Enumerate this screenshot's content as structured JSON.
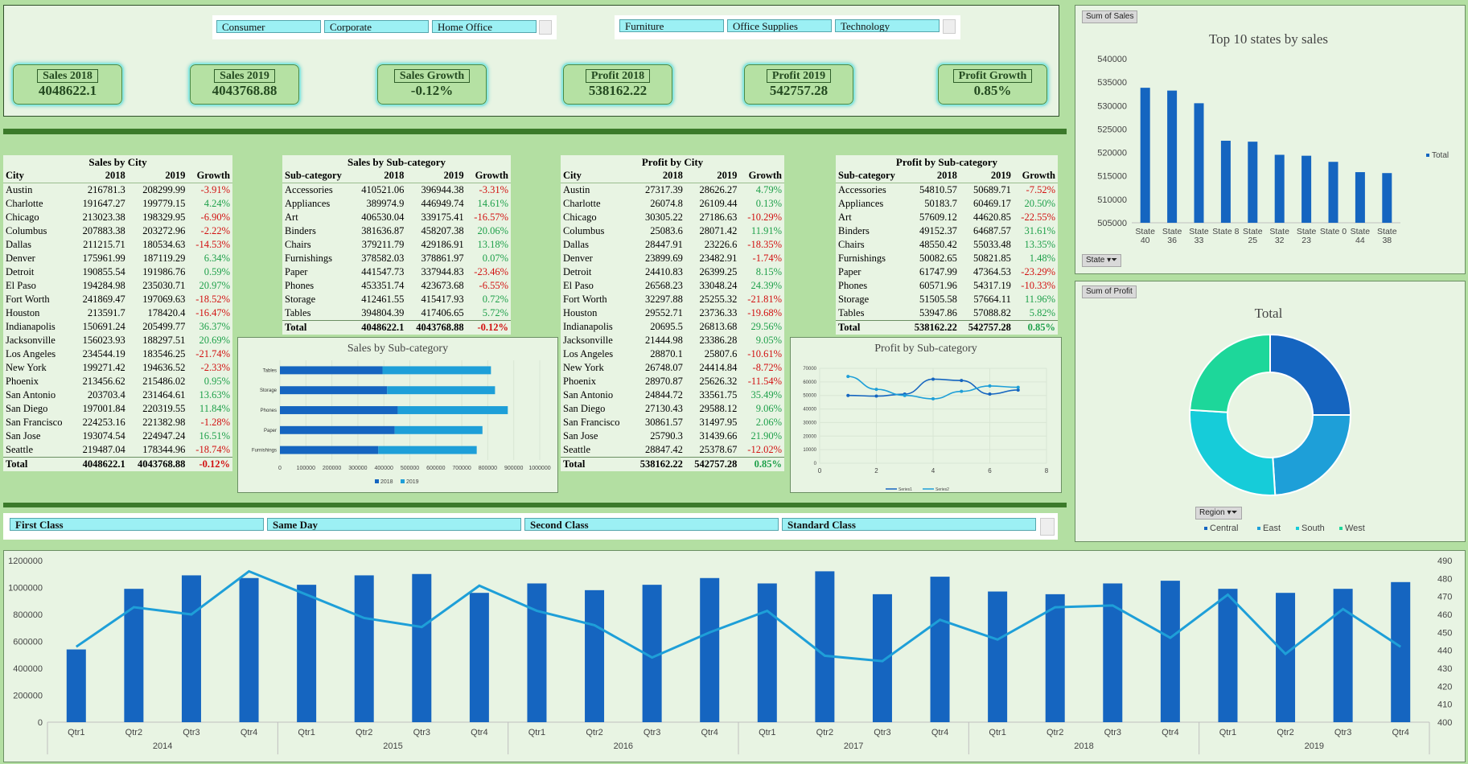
{
  "segment_slicer": [
    "Consumer",
    "Corporate",
    "Home Office"
  ],
  "category_slicer": [
    "Furniture",
    "Office Supplies",
    "Technology"
  ],
  "ship_slicer": [
    "First Class",
    "Same Day",
    "Second Class",
    "Standard Class"
  ],
  "kpis": [
    {
      "label": "Sales 2018",
      "value": "4048622.1"
    },
    {
      "label": "Sales 2019",
      "value": "4043768.88"
    },
    {
      "label": "Sales Growth",
      "value": "-0.12%"
    },
    {
      "label": "Profit 2018",
      "value": "538162.22"
    },
    {
      "label": "Profit 2019",
      "value": "542757.28"
    },
    {
      "label": "Profit Growth",
      "value": "0.85%"
    }
  ],
  "tables": {
    "sales_city": {
      "title": "Sales by City",
      "headers": [
        "City",
        "2018",
        "2019",
        "Growth"
      ],
      "rows": [
        [
          "Austin",
          "216781.3",
          "208299.99",
          "-3.91%"
        ],
        [
          "Charlotte",
          "191647.27",
          "199779.15",
          "4.24%"
        ],
        [
          "Chicago",
          "213023.38",
          "198329.95",
          "-6.90%"
        ],
        [
          "Columbus",
          "207883.38",
          "203272.96",
          "-2.22%"
        ],
        [
          "Dallas",
          "211215.71",
          "180534.63",
          "-14.53%"
        ],
        [
          "Denver",
          "175961.99",
          "187119.29",
          "6.34%"
        ],
        [
          "Detroit",
          "190855.54",
          "191986.76",
          "0.59%"
        ],
        [
          "El Paso",
          "194284.98",
          "235030.71",
          "20.97%"
        ],
        [
          "Fort Worth",
          "241869.47",
          "197069.63",
          "-18.52%"
        ],
        [
          "Houston",
          "213591.7",
          "178420.4",
          "-16.47%"
        ],
        [
          "Indianapolis",
          "150691.24",
          "205499.77",
          "36.37%"
        ],
        [
          "Jacksonville",
          "156023.93",
          "188297.51",
          "20.69%"
        ],
        [
          "Los Angeles",
          "234544.19",
          "183546.25",
          "-21.74%"
        ],
        [
          "New York",
          "199271.42",
          "194636.52",
          "-2.33%"
        ],
        [
          "Phoenix",
          "213456.62",
          "215486.02",
          "0.95%"
        ],
        [
          "San Antonio",
          "203703.4",
          "231464.61",
          "13.63%"
        ],
        [
          "San Diego",
          "197001.84",
          "220319.55",
          "11.84%"
        ],
        [
          "San Francisco",
          "224253.16",
          "221382.98",
          "-1.28%"
        ],
        [
          "San Jose",
          "193074.54",
          "224947.24",
          "16.51%"
        ],
        [
          "Seattle",
          "219487.04",
          "178344.96",
          "-18.74%"
        ]
      ],
      "total": [
        "Total",
        "4048622.1",
        "4043768.88",
        "-0.12%"
      ]
    },
    "sales_sub": {
      "title": "Sales by Sub-category",
      "headers": [
        "Sub-category",
        "2018",
        "2019",
        "Growth"
      ],
      "rows": [
        [
          "Accessories",
          "410521.06",
          "396944.38",
          "-3.31%"
        ],
        [
          "Appliances",
          "389974.9",
          "446949.74",
          "14.61%"
        ],
        [
          "Art",
          "406530.04",
          "339175.41",
          "-16.57%"
        ],
        [
          "Binders",
          "381636.87",
          "458207.38",
          "20.06%"
        ],
        [
          "Chairs",
          "379211.79",
          "429186.91",
          "13.18%"
        ],
        [
          "Furnishings",
          "378582.03",
          "378861.97",
          "0.07%"
        ],
        [
          "Paper",
          "441547.73",
          "337944.83",
          "-23.46%"
        ],
        [
          "Phones",
          "453351.74",
          "423673.68",
          "-6.55%"
        ],
        [
          "Storage",
          "412461.55",
          "415417.93",
          "0.72%"
        ],
        [
          "Tables",
          "394804.39",
          "417406.65",
          "5.72%"
        ]
      ],
      "total": [
        "Total",
        "4048622.1",
        "4043768.88",
        "-0.12%"
      ]
    },
    "profit_city": {
      "title": "Profit by City",
      "headers": [
        "City",
        "2018",
        "2019",
        "Growth"
      ],
      "rows": [
        [
          "Austin",
          "27317.39",
          "28626.27",
          "4.79%"
        ],
        [
          "Charlotte",
          "26074.8",
          "26109.44",
          "0.13%"
        ],
        [
          "Chicago",
          "30305.22",
          "27186.63",
          "-10.29%"
        ],
        [
          "Columbus",
          "25083.6",
          "28071.42",
          "11.91%"
        ],
        [
          "Dallas",
          "28447.91",
          "23226.6",
          "-18.35%"
        ],
        [
          "Denver",
          "23899.69",
          "23482.91",
          "-1.74%"
        ],
        [
          "Detroit",
          "24410.83",
          "26399.25",
          "8.15%"
        ],
        [
          "El Paso",
          "26568.23",
          "33048.24",
          "24.39%"
        ],
        [
          "Fort Worth",
          "32297.88",
          "25255.32",
          "-21.81%"
        ],
        [
          "Houston",
          "29552.71",
          "23736.33",
          "-19.68%"
        ],
        [
          "Indianapolis",
          "20695.5",
          "26813.68",
          "29.56%"
        ],
        [
          "Jacksonville",
          "21444.98",
          "23386.28",
          "9.05%"
        ],
        [
          "Los Angeles",
          "28870.1",
          "25807.6",
          "-10.61%"
        ],
        [
          "New York",
          "26748.07",
          "24414.84",
          "-8.72%"
        ],
        [
          "Phoenix",
          "28970.87",
          "25626.32",
          "-11.54%"
        ],
        [
          "San Antonio",
          "24844.72",
          "33561.75",
          "35.49%"
        ],
        [
          "San Diego",
          "27130.43",
          "29588.12",
          "9.06%"
        ],
        [
          "San Francisco",
          "30861.57",
          "31497.95",
          "2.06%"
        ],
        [
          "San Jose",
          "25790.3",
          "31439.66",
          "21.90%"
        ],
        [
          "Seattle",
          "28847.42",
          "25378.67",
          "-12.02%"
        ]
      ],
      "total": [
        "Total",
        "538162.22",
        "542757.28",
        "0.85%"
      ]
    },
    "profit_sub": {
      "title": "Profit by Sub-category",
      "headers": [
        "Sub-category",
        "2018",
        "2019",
        "Growth"
      ],
      "rows": [
        [
          "Accessories",
          "54810.57",
          "50689.71",
          "-7.52%"
        ],
        [
          "Appliances",
          "50183.7",
          "60469.17",
          "20.50%"
        ],
        [
          "Art",
          "57609.12",
          "44620.85",
          "-22.55%"
        ],
        [
          "Binders",
          "49152.37",
          "64687.57",
          "31.61%"
        ],
        [
          "Chairs",
          "48550.42",
          "55033.48",
          "13.35%"
        ],
        [
          "Furnishings",
          "50082.65",
          "50821.85",
          "1.48%"
        ],
        [
          "Paper",
          "61747.99",
          "47364.53",
          "-23.29%"
        ],
        [
          "Phones",
          "60571.96",
          "54317.19",
          "-10.33%"
        ],
        [
          "Storage",
          "51505.58",
          "57664.11",
          "11.96%"
        ],
        [
          "Tables",
          "53947.86",
          "57088.82",
          "5.82%"
        ]
      ],
      "total": [
        "Total",
        "538162.22",
        "542757.28",
        "0.85%"
      ]
    }
  },
  "pivot_buttons": {
    "sum_sales": "Sum of Sales",
    "state": "State",
    "sum_profit": "Sum of Profit",
    "region": "Region"
  },
  "chart_data": [
    {
      "type": "bar",
      "title": "Sales by Sub-category",
      "categories": [
        "Furnishings",
        "Paper",
        "Phones",
        "Storage",
        "Tables"
      ],
      "series": [
        {
          "name": "2018",
          "values": [
            378582.03,
            441547.73,
            453351.74,
            412461.55,
            394804.39
          ],
          "color": "#1565c0"
        },
        {
          "name": "2019",
          "values": [
            378861.97,
            337944.83,
            423673.68,
            415417.93,
            417406.65
          ],
          "color": "#1e9fd8"
        }
      ],
      "orientation": "horizontal-stacked",
      "xlim": [
        0,
        1000000
      ],
      "xticks": [
        0,
        100000,
        200000,
        300000,
        400000,
        500000,
        600000,
        700000,
        800000,
        900000,
        1000000
      ],
      "legend": "bottom"
    },
    {
      "type": "line",
      "title": "Profit by Sub-category",
      "series": [
        {
          "name": "Series1",
          "x": [
            1,
            2,
            3,
            4,
            5,
            6,
            7
          ],
          "values": [
            50000,
            49500,
            51000,
            62000,
            61000,
            51000,
            54000
          ],
          "color": "#1565c0"
        },
        {
          "name": "Series2",
          "x": [
            1,
            2,
            3,
            4,
            5,
            6,
            7
          ],
          "values": [
            64000,
            54500,
            50000,
            47500,
            53000,
            57000,
            56000
          ],
          "color": "#1e9fd8"
        }
      ],
      "xlim": [
        0,
        8
      ],
      "xticks": [
        0,
        2,
        4,
        6,
        8
      ],
      "ylim": [
        0,
        70000
      ],
      "yticks": [
        0,
        10000,
        20000,
        30000,
        40000,
        50000,
        60000,
        70000
      ],
      "legend": "bottom"
    },
    {
      "type": "bar",
      "title": "Top 10 states by sales",
      "categories": [
        [
          "State",
          "40"
        ],
        [
          "State",
          "36"
        ],
        [
          "State",
          "33"
        ],
        [
          "State 8"
        ],
        [
          "State",
          "25"
        ],
        [
          "State",
          "32"
        ],
        [
          "State",
          "23"
        ],
        [
          "State 0"
        ],
        [
          "State",
          "44"
        ],
        [
          "State",
          "38"
        ]
      ],
      "series": [
        {
          "name": "Total",
          "values": [
            533800,
            533200,
            530500,
            522500,
            522300,
            519500,
            519300,
            518000,
            515800,
            515600
          ],
          "color": "#1565c0"
        }
      ],
      "ylim": [
        505000,
        540000
      ],
      "yticks": [
        505000,
        510000,
        515000,
        520000,
        525000,
        530000,
        535000,
        540000
      ],
      "legend": "right"
    },
    {
      "type": "pie",
      "subtype": "doughnut",
      "title": "Total",
      "labels": [
        "Central",
        "East",
        "South",
        "West"
      ],
      "values": [
        25,
        24,
        27,
        24
      ],
      "colors": [
        "#1565c0",
        "#1e9fd8",
        "#16ccd9",
        "#1dd79a"
      ],
      "legend": "bottom"
    },
    {
      "type": "bar",
      "subtype": "combo bar + line",
      "categories": [
        "Qtr1",
        "Qtr2",
        "Qtr3",
        "Qtr4",
        "Qtr1",
        "Qtr2",
        "Qtr3",
        "Qtr4",
        "Qtr1",
        "Qtr2",
        "Qtr3",
        "Qtr4",
        "Qtr1",
        "Qtr2",
        "Qtr3",
        "Qtr4",
        "Qtr1",
        "Qtr2",
        "Qtr3",
        "Qtr4",
        "Qtr1",
        "Qtr2",
        "Qtr3",
        "Qtr4"
      ],
      "groups": [
        "2014",
        "2015",
        "2016",
        "2017",
        "2018",
        "2019"
      ],
      "series": [
        {
          "type": "bar",
          "axis": "left",
          "color": "#1565c0",
          "values": [
            540000,
            990000,
            1090000,
            1070000,
            1020000,
            1090000,
            1100000,
            960000,
            1030000,
            980000,
            1020000,
            1070000,
            1030000,
            1120000,
            950000,
            1080000,
            970000,
            950000,
            1030000,
            1050000,
            990000,
            960000,
            990000,
            1040000
          ]
        },
        {
          "type": "line",
          "axis": "right",
          "color": "#1e9fd8",
          "values": [
            442,
            464,
            460,
            484,
            471,
            458,
            453,
            476,
            462,
            454,
            436,
            450,
            462,
            437,
            434,
            457,
            446,
            464,
            465,
            447,
            471,
            438,
            463,
            442
          ]
        }
      ],
      "ylim": [
        0,
        1200000
      ],
      "yticks": [
        0,
        200000,
        400000,
        600000,
        800000,
        1000000,
        1200000
      ],
      "y2lim": [
        400,
        490
      ],
      "y2ticks": [
        400,
        410,
        420,
        430,
        440,
        450,
        460,
        470,
        480,
        490
      ]
    }
  ]
}
